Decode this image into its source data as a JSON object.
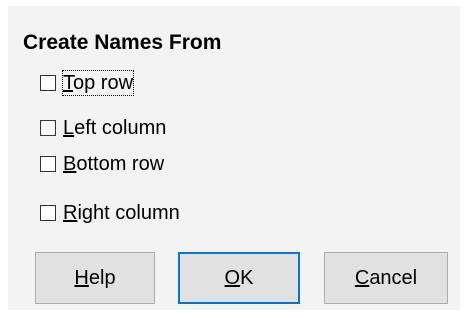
{
  "dialog": {
    "section_title": "Create Names From",
    "options": [
      {
        "mnemonic": "T",
        "rest": "op row",
        "checked": false,
        "focused": true
      },
      {
        "mnemonic": "L",
        "rest": "eft column",
        "checked": false,
        "focused": false
      },
      {
        "mnemonic": "B",
        "rest": "ottom row",
        "checked": false,
        "focused": false
      },
      {
        "mnemonic": "R",
        "rest": "ight column",
        "checked": false,
        "focused": false
      }
    ],
    "buttons": {
      "help": {
        "mnemonic": "H",
        "rest": "elp"
      },
      "ok": {
        "mnemonic": "O",
        "rest": "K"
      },
      "cancel": {
        "mnemonic": "C",
        "rest": "ancel"
      }
    },
    "accent_color": "#0078d7"
  }
}
